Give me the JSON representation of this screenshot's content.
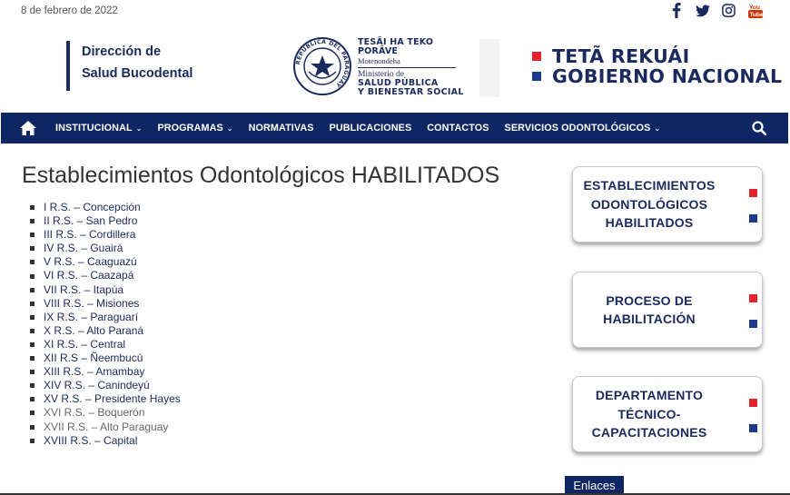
{
  "topbar": {
    "date": "8 de febrero de 2022",
    "social": [
      {
        "name": "facebook-icon",
        "color": "#1b2a5e"
      },
      {
        "name": "twitter-icon",
        "color": "#1b2a5e"
      },
      {
        "name": "instagram-icon",
        "color": "#1b2a5e"
      },
      {
        "name": "youtube-icon",
        "color": "#cc3300"
      }
    ]
  },
  "header": {
    "brand_line1": "Dirección de",
    "brand_line2": "Salud Bucodental",
    "seal_ring_text": "REPÚBLICA DEL PARAGUAY",
    "seal_t1": "TESÃI HA TEKO",
    "seal_t1b": "PORÃVE",
    "seal_t2": "Motenondeha",
    "seal_t3": "Ministerio de",
    "seal_t4a": "SALUD PÚBLICA",
    "seal_t4b": "Y BIENESTAR SOCIAL",
    "gov_line1": "TETÃ REKUÁI",
    "gov_line2": "GOBIERNO NACIONAL",
    "colors": {
      "red": "#e3232e",
      "blue": "#1b3a8c",
      "navy": "#1b2a5e"
    }
  },
  "nav": {
    "items": [
      {
        "label": "INSTITUCIONAL",
        "dropdown": true
      },
      {
        "label": "PROGRAMAS",
        "dropdown": true
      },
      {
        "label": "NORMATIVAS",
        "dropdown": false
      },
      {
        "label": "PUBLICACIONES",
        "dropdown": false
      },
      {
        "label": "CONTACTOS",
        "dropdown": false
      },
      {
        "label": "SERVICIOS ODONTOLÓGICOS",
        "dropdown": true
      }
    ],
    "background": "#0e2663"
  },
  "main": {
    "title": "Establecimientos Odontológicos HABILITADOS",
    "regions": [
      {
        "label": "I R.S. – Concepción",
        "style": "link"
      },
      {
        "label": "II R.S. – San Pedro",
        "style": "link"
      },
      {
        "label": "III R.S. – Cordillera",
        "style": "link"
      },
      {
        "label": "IV R.S. – Guairá",
        "style": "link"
      },
      {
        "label": "V R.S. – Caaguazú",
        "style": "link"
      },
      {
        "label": "VI R.S. – Caazapá",
        "style": "link"
      },
      {
        "label": "VII R.S. – Itapúa",
        "style": "link"
      },
      {
        "label": "VIII R.S. – Misiones",
        "style": "link"
      },
      {
        "label": "IX R.S. – Paraguarí",
        "style": "link"
      },
      {
        "label": "X R.S. – Alto Paraná",
        "style": "link"
      },
      {
        "label": "XI R.S. – Central",
        "style": "link"
      },
      {
        "label": "XII R.S – Ñeembucú",
        "style": "link"
      },
      {
        "label": "XIII R.S. – Amambay",
        "style": "link"
      },
      {
        "label": "XIV R.S. – Canindeyú",
        "style": "link"
      },
      {
        "label": "XV R.S. – Presidente Hayes",
        "style": "link"
      },
      {
        "label": "XVI R.S. – Boquerón",
        "style": "light"
      },
      {
        "label": "XVII R.S. – Alto Paraguay",
        "style": "light"
      },
      {
        "label": "XVIII R.S. – Capital",
        "style": "link"
      }
    ]
  },
  "sidebar": {
    "cards": [
      {
        "line1": "ESTABLECIMIENTOS",
        "line2": "ODONTOLÓGICOS",
        "line3": "HABILITADOS"
      },
      {
        "line1": "PROCESO DE",
        "line2": "HABILITACIÓN",
        "line3": ""
      },
      {
        "line1": "DEPARTAMENTO",
        "line2": "TÉCNICO-",
        "line3": "CAPACITACIONES"
      }
    ],
    "enlaces": "Enlaces"
  }
}
